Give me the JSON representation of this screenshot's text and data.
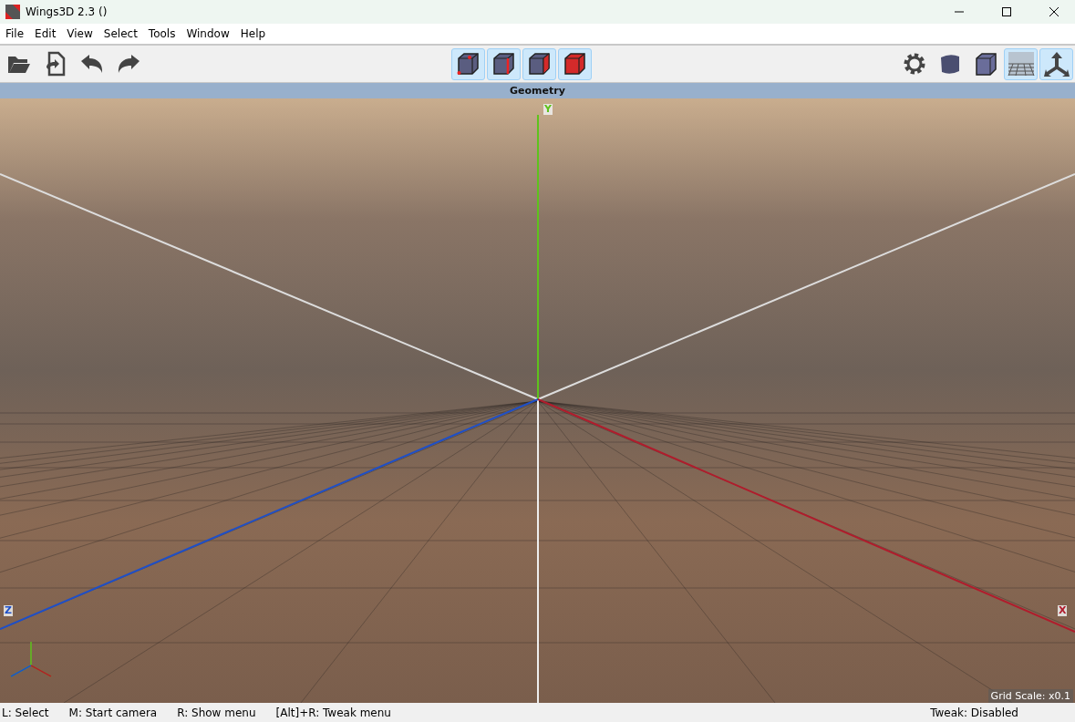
{
  "window": {
    "title": "Wings3D 2.3 ()"
  },
  "menu": [
    "File",
    "Edit",
    "View",
    "Select",
    "Tools",
    "Window",
    "Help"
  ],
  "toolbar_left": [
    {
      "kind": "open"
    },
    {
      "kind": "import"
    },
    {
      "kind": "undo"
    },
    {
      "kind": "redo"
    }
  ],
  "select_modes": [
    {
      "kind": "vertex",
      "on": true
    },
    {
      "kind": "edge",
      "on": true
    },
    {
      "kind": "face",
      "on": true
    },
    {
      "kind": "body",
      "on": true
    }
  ],
  "toolbar_right": [
    {
      "kind": "settings",
      "on": false
    },
    {
      "kind": "smooth",
      "on": false
    },
    {
      "kind": "wire",
      "on": false
    },
    {
      "kind": "ground",
      "on": true
    },
    {
      "kind": "axes",
      "on": true
    }
  ],
  "viewport": {
    "title": "Geometry",
    "axis_labels": {
      "x": "X",
      "y": "Y",
      "z": "Z"
    },
    "grid_scale": "Grid Scale: x0.1"
  },
  "status_bar": {
    "hints": [
      "L: Select",
      "M: Start camera",
      "R: Show menu",
      "[Alt]+R: Tweak menu"
    ],
    "right": "Tweak: Disabled"
  }
}
